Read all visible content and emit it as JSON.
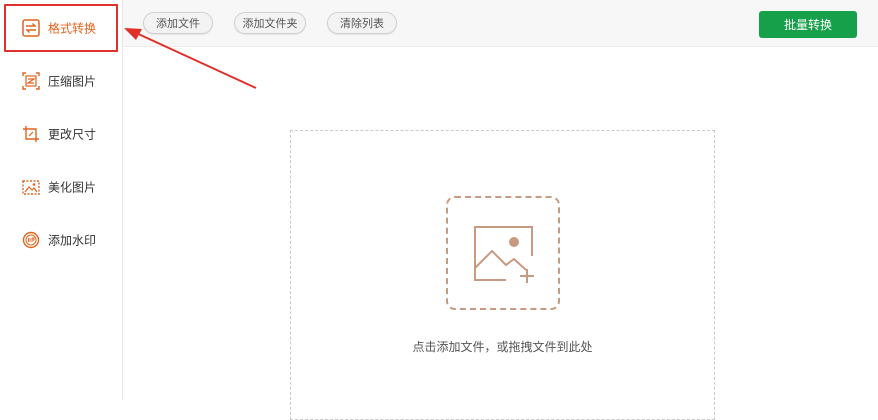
{
  "sidebar": {
    "items": [
      {
        "label": "格式转换",
        "icon": "format-convert-icon",
        "active": true
      },
      {
        "label": "压缩图片",
        "icon": "compress-image-icon",
        "active": false
      },
      {
        "label": "更改尺寸",
        "icon": "resize-icon",
        "active": false
      },
      {
        "label": "美化图片",
        "icon": "beautify-image-icon",
        "active": false
      },
      {
        "label": "添加水印",
        "icon": "watermark-icon",
        "active": false
      }
    ]
  },
  "toolbar": {
    "add_file": "添加文件",
    "add_folder": "添加文件夹",
    "clear_list": "清除列表",
    "batch_convert": "批量转换"
  },
  "dropzone": {
    "hint": "点击添加文件，或拖拽文件到此处",
    "icon": "add-image-icon"
  },
  "colors": {
    "accent": "#e0641e",
    "primary_button": "#17a04a",
    "annotation_red": "#e0302a",
    "icon_tan": "#c89a82"
  }
}
